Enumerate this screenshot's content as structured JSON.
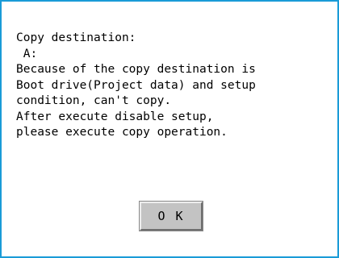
{
  "dialog": {
    "border_color": "#1a9bd7",
    "message_lines": [
      "Copy destination:",
      " A:",
      "Because of the copy destination is",
      "Boot drive(Project data) and setup",
      "condition, can't copy.",
      "After execute disable setup,",
      "please execute copy operation."
    ],
    "ok_label": "O K"
  }
}
